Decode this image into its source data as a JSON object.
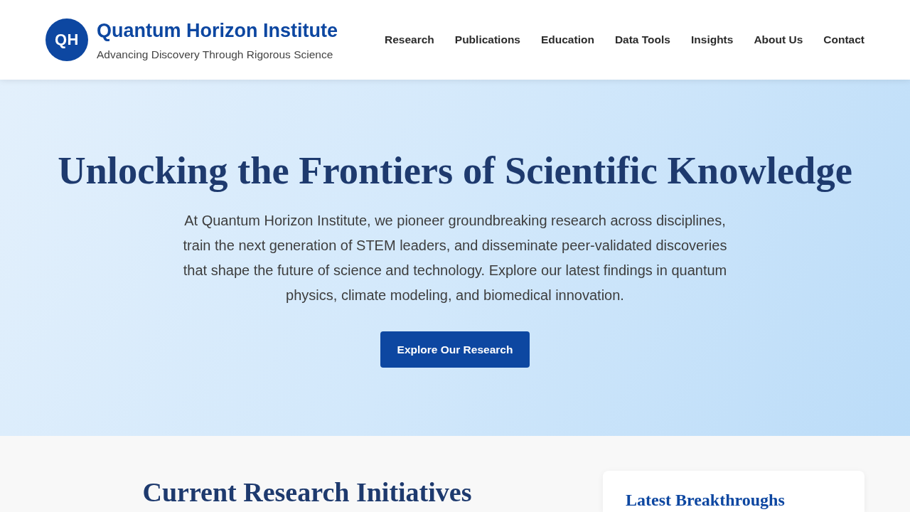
{
  "header": {
    "logo": {
      "initials": "QH"
    },
    "title": "Quantum Horizon Institute",
    "tagline": "Advancing Discovery Through Rigorous Science",
    "nav": [
      "Research",
      "Publications",
      "Education",
      "Data Tools",
      "Insights",
      "About Us",
      "Contact"
    ]
  },
  "hero": {
    "heading": "Unlocking the Frontiers of Scientific Knowledge",
    "text": "At Quantum Horizon Institute, we pioneer groundbreaking research across disciplines, train the next generation of STEM leaders, and disseminate peer-validated discoveries that shape the future of science and technology. Explore our latest findings in quantum physics, climate modeling, and biomedical innovation.",
    "button": "Explore Our Research"
  },
  "research_section": {
    "heading": "Current Research Initiatives"
  },
  "sidebar_card": {
    "heading": "Latest Breakthroughs"
  }
}
